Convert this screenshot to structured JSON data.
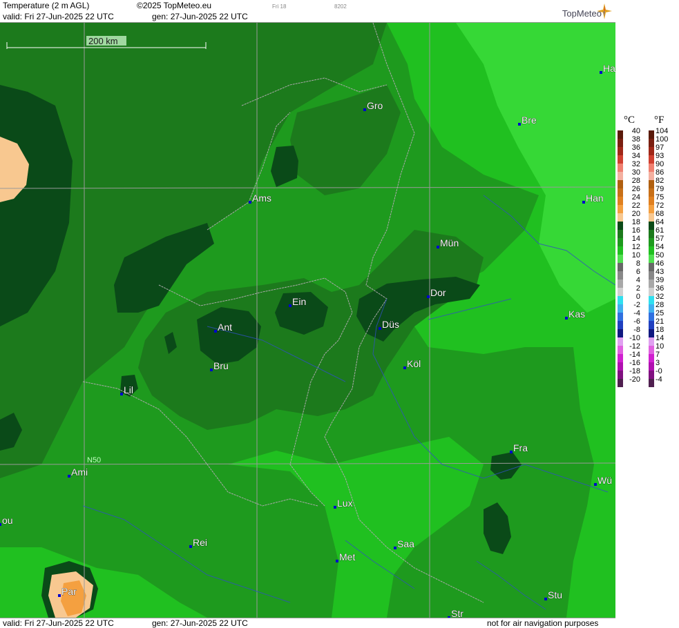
{
  "header": {
    "title": "Temperature (2 m AGL)",
    "copyright": "©2025 TopMeteo.eu",
    "day_code": "Fri 18",
    "code": "8202",
    "valid": "valid:  Fri  27-Jun-2025  22 UTC",
    "gen": "gen: 27-Jun-2025 22 UTC",
    "brand": "TopMeteo"
  },
  "scale_bar": {
    "label": "200 km"
  },
  "grid_label": "N50",
  "cities": [
    "Ha",
    "Gro",
    "Bre",
    "Ams",
    "Han",
    "Mün",
    "Ein",
    "Dor",
    "Ant",
    "Düs",
    "Kas",
    "Bru",
    "Köl",
    "Lil",
    "Fra",
    "Ami",
    "Wü",
    "Lux",
    "ou",
    "Rei",
    "Saa",
    "Met",
    "Par",
    "Stu",
    "Str"
  ],
  "footer": {
    "valid": "valid:  Fri  27-Jun-2025  22 UTC",
    "gen": "gen: 27-Jun-2025 22 UTC",
    "disclaimer": "not for air navigation purposes"
  },
  "legend": {
    "unit_c": "°C",
    "unit_f": "°F",
    "celsius": [
      "40",
      "38",
      "36",
      "34",
      "32",
      "30",
      "28",
      "26",
      "24",
      "22",
      "20",
      "18",
      "16",
      "14",
      "12",
      "10",
      "8",
      "6",
      "4",
      "2",
      "0",
      "-2",
      "-4",
      "-6",
      "-8",
      "-10",
      "-12",
      "-14",
      "-16",
      "-18",
      "-20"
    ],
    "fahrenheit": [
      "104",
      "100",
      "97",
      "93",
      "90",
      "86",
      "82",
      "79",
      "75",
      "72",
      "68",
      "64",
      "61",
      "57",
      "54",
      "50",
      "46",
      "43",
      "39",
      "36",
      "32",
      "28",
      "25",
      "21",
      "18",
      "14",
      "10",
      "7",
      "3",
      "-0",
      "-4"
    ],
    "colors": [
      "#5a1a0a",
      "#7a1f10",
      "#a02818",
      "#d04030",
      "#f08070",
      "#f4b0a0",
      "#b06010",
      "#c87018",
      "#e08020",
      "#f4a040",
      "#f8c890",
      "#0a4a18",
      "#1c7a1c",
      "#1e9a1e",
      "#20c020",
      "#50e050",
      "#686868",
      "#888888",
      "#a8a8a8",
      "#d0d0d0",
      "#30e0f0",
      "#40b0f0",
      "#3070e0",
      "#2040c0",
      "#101880",
      "#e0a0f0",
      "#e060e0",
      "#d020d0",
      "#b010b0",
      "#801080",
      "#502050"
    ]
  }
}
